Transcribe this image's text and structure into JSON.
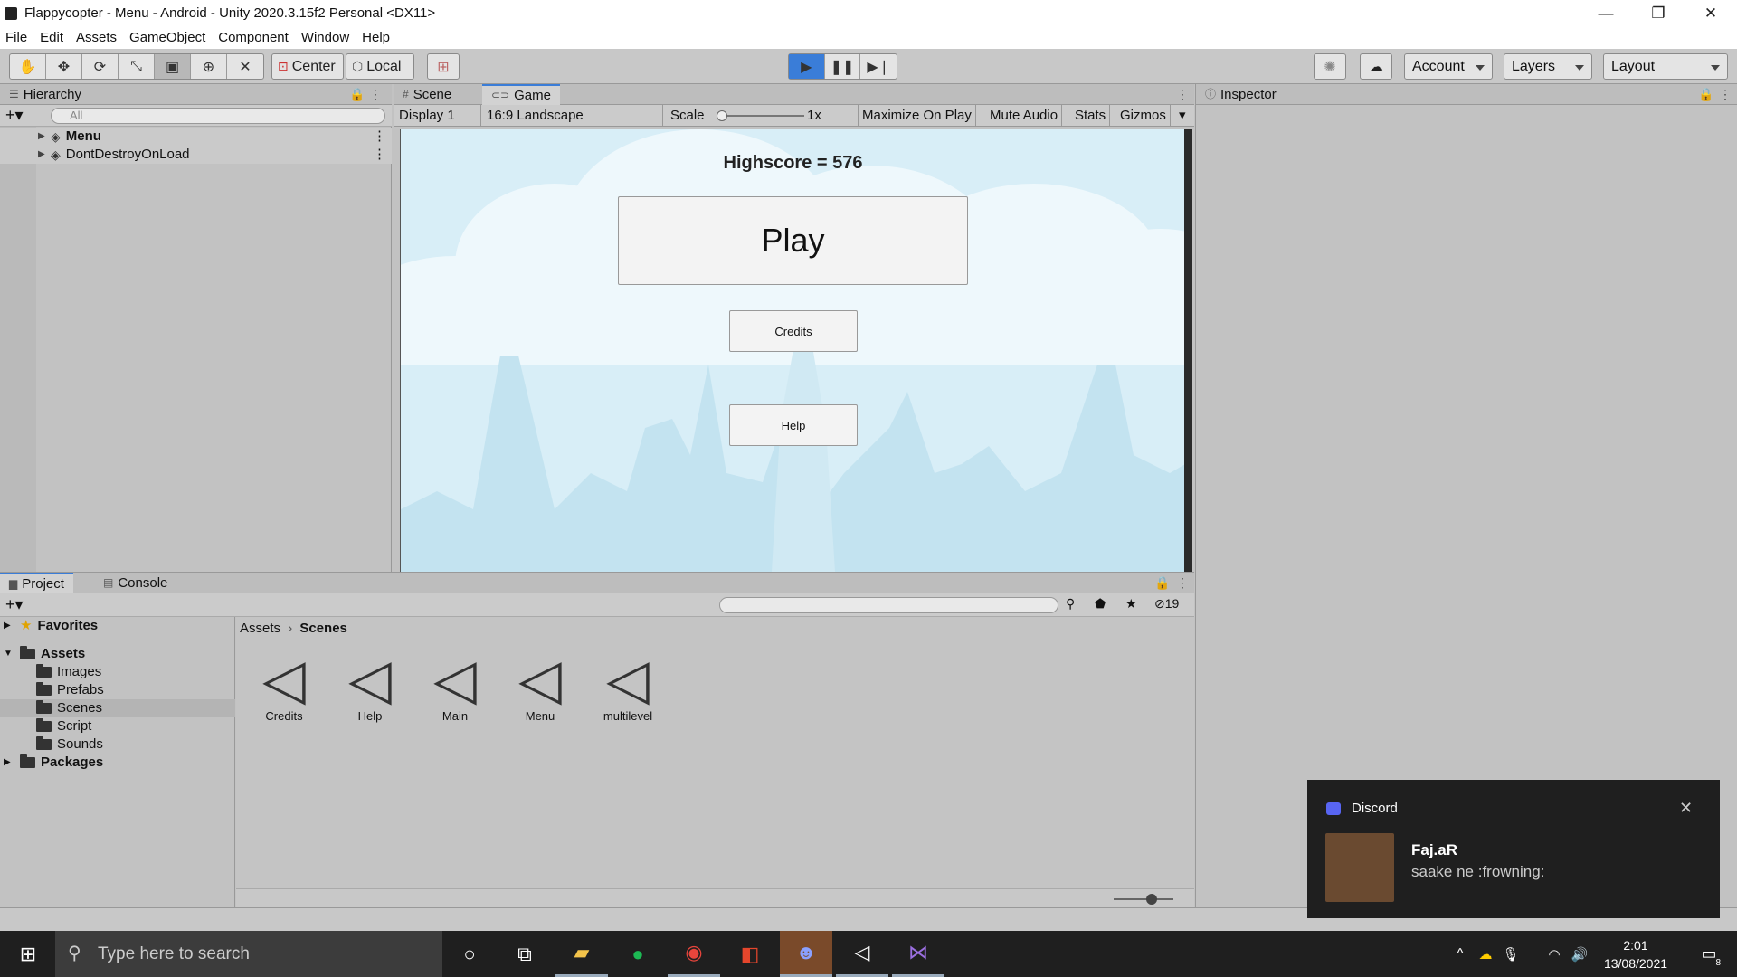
{
  "window": {
    "title": "Flappycopter - Menu - Android - Unity 2020.3.15f2 Personal <DX11>",
    "minimize": "—",
    "restore": "❐",
    "close": "✕"
  },
  "menu": [
    "File",
    "Edit",
    "Assets",
    "GameObject",
    "Component",
    "Window",
    "Help"
  ],
  "toolbar": {
    "pivot": "Center",
    "space": "Local",
    "account": "Account",
    "layers": "Layers",
    "layout": "Layout"
  },
  "hierarchy": {
    "tab": "Hierarchy",
    "search_placeholder": "All",
    "items": [
      "Menu",
      "DontDestroyOnLoad"
    ]
  },
  "tabs": {
    "scene": "Scene",
    "game": "Game",
    "inspector": "Inspector",
    "project": "Project",
    "console": "Console"
  },
  "gamebar": {
    "display": "Display 1",
    "aspect": "16:9 Landscape",
    "scale_label": "Scale",
    "scale_value": "1x",
    "maximize": "Maximize On Play",
    "mute": "Mute Audio",
    "stats": "Stats",
    "gizmos": "Gizmos"
  },
  "game": {
    "highscore": "Highscore = 576",
    "play": "Play",
    "credits": "Credits",
    "help": "Help"
  },
  "project": {
    "hidden_count": "19",
    "breadcrumb": [
      "Assets",
      "Scenes"
    ],
    "tree": [
      "Favorites",
      "Assets",
      "Images",
      "Prefabs",
      "Scenes",
      "Script",
      "Sounds",
      "Packages"
    ],
    "files": [
      "Credits",
      "Help",
      "Main",
      "Menu",
      "multilevel"
    ]
  },
  "taskbar": {
    "search_placeholder": "Type here to search",
    "time": "2:01",
    "date": "13/08/2021",
    "notif_count": "8"
  },
  "toast": {
    "app": "Discord",
    "user": "Faj.aR",
    "message": "saake ne :frowning:"
  },
  "colors": {
    "accent": "#3a7dd8",
    "sky": "#d8eef7"
  }
}
